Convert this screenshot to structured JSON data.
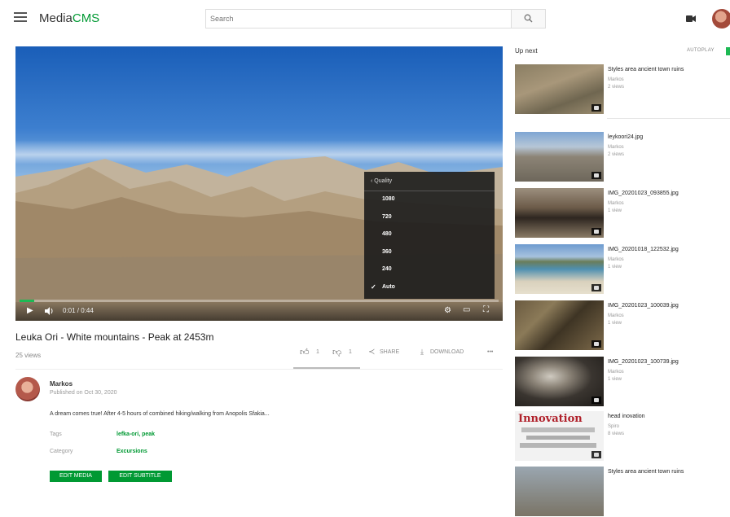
{
  "header": {
    "logo_main": "Media",
    "logo_accent": "CMS",
    "search_placeholder": "Search"
  },
  "player": {
    "time": "0:01 / 0:44",
    "progress_fraction": 0.03,
    "quality_menu": {
      "header": "Quality",
      "options": [
        "1080",
        "720",
        "480",
        "360",
        "240",
        "Auto"
      ],
      "selected": "Auto"
    }
  },
  "video": {
    "title": "Leuka Ori - White mountains - Peak at 2453m",
    "views": "25 views",
    "likes": "1",
    "dislikes": "1",
    "share_label": "SHARE",
    "download_label": "DOWNLOAD",
    "more_label": "•••",
    "author": "Markos",
    "published": "Published on Oct 30, 2020",
    "description": "A dream comes true! After 4-5 hours of combined hiking/walking from Anopolis Sfakia...",
    "tags_label": "Tags",
    "tags_value": "lefka-ori, peak",
    "category_label": "Category",
    "category_value": "Excursions",
    "buttons": [
      "EDIT MEDIA",
      "EDIT SUBTITLE"
    ]
  },
  "sidebar": {
    "up_next": "Up next",
    "autoplay": "AUTOPLAY",
    "items": [
      {
        "title": "Styles area ancient town ruins",
        "author": "Markos",
        "views": "2 views"
      },
      {
        "title": "leykoori24.jpg",
        "author": "Markos",
        "views": "2 views"
      },
      {
        "title": "IMG_20201023_093855.jpg",
        "author": "Markos",
        "views": "1 view"
      },
      {
        "title": "IMG_20201018_122532.jpg",
        "author": "Markos",
        "views": "1 view"
      },
      {
        "title": "IMG_20201023_100039.jpg",
        "author": "Markos",
        "views": "1 view"
      },
      {
        "title": "IMG_20201023_100739.jpg",
        "author": "Markos",
        "views": "1 view"
      },
      {
        "title": "head inovation",
        "author": "Spiro",
        "views": "8 views",
        "thumb_text": "Innovation"
      },
      {
        "title": "Styles area ancient town ruins",
        "author": "",
        "views": ""
      }
    ]
  },
  "colors": {
    "accent": "#009933",
    "toggle": "#1db954"
  }
}
